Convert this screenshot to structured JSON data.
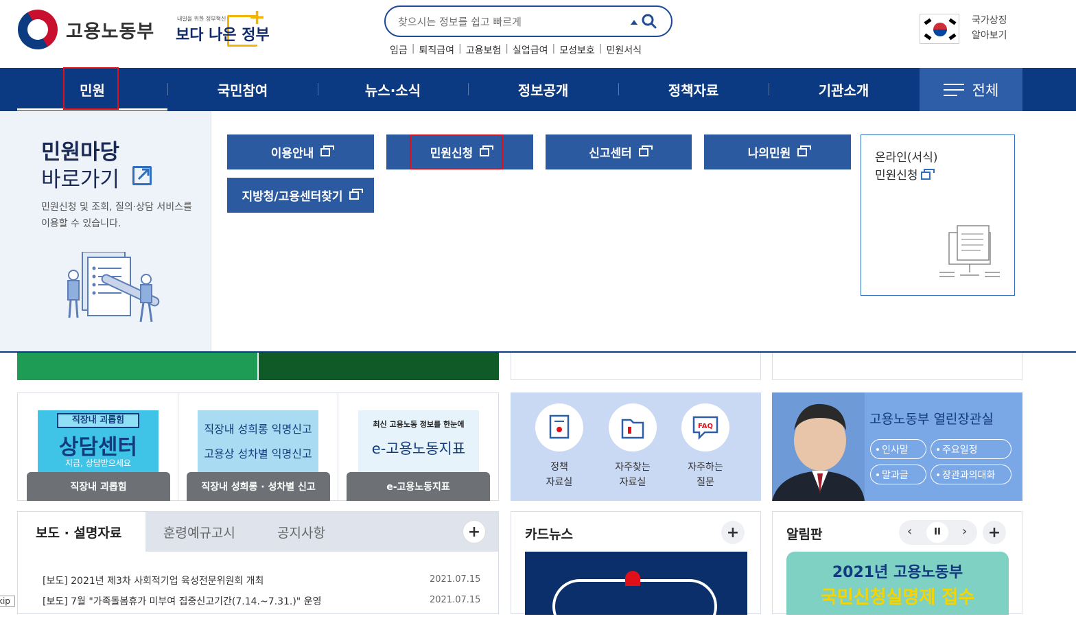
{
  "header": {
    "logo_text": "고용노동부",
    "slogan_small": "내일을 위한 정부혁신",
    "slogan_big": "보다 나은 정부",
    "search_placeholder": "찾으시는 정보를 쉽고 빠르게",
    "quick_links": [
      "임금",
      "퇴직급여",
      "고용보험",
      "실업급여",
      "모성보호",
      "민원서식"
    ],
    "national_symbol_line1": "국가상징",
    "national_symbol_line2": "알아보기"
  },
  "gnb": {
    "items": [
      "민원",
      "국민참여",
      "뉴스·소식",
      "정보공개",
      "정책자료",
      "기관소개"
    ],
    "all_label": "전체"
  },
  "dropdown": {
    "title_line1": "민원마당",
    "title_line2": "바로가기",
    "description": "민원신청 및 조회, 질의·상담 서비스를 이용할 수 있습니다.",
    "buttons": [
      "이용안내",
      "민원신청",
      "신고센터",
      "나의민원",
      "지방청/고용센터찾기"
    ],
    "online_line1": "온라인(서식)",
    "online_line2": "민원신청"
  },
  "promos": [
    {
      "top": "직장내 괴롭힘",
      "main": "상담센터",
      "sub": "지금, 상담받으세요",
      "label": "직장내 괴롭힘"
    },
    {
      "top": "직장내 성희롱 익명신고",
      "main": "고용상 성차별 익명신고",
      "label": "직장내 성희롱 · 성차별 신고"
    },
    {
      "top": "최신 고용노동 정보를 한눈에",
      "main": "e-고용노동지표",
      "label": "e-고용노동지표"
    }
  ],
  "quick_menu": [
    {
      "line1": "정책",
      "line2": "자료실",
      "icon": "book-icon"
    },
    {
      "line1": "자주찾는",
      "line2": "자료실",
      "icon": "folder-icon"
    },
    {
      "line1": "자주하는",
      "line2": "질문",
      "icon": "faq-icon"
    }
  ],
  "minister": {
    "title": "고용노동부 열린장관실",
    "pills": [
      "인사말",
      "주요일정",
      "말과글",
      "장관과의대화"
    ]
  },
  "news": {
    "tabs": [
      "보도 · 설명자료",
      "훈령예규고시",
      "공지사항"
    ],
    "rows": [
      {
        "text": "[보도] 2021년 제3차 사회적기업 육성전문위원회 개최",
        "date": "2021.07.15"
      },
      {
        "text": "[보도] 7월 \"가족돌봄휴가 미부여 집중신고기간(7.14.~7.31.)\" 운영",
        "date": "2021.07.15"
      }
    ]
  },
  "cardnews": {
    "title": "카드뉴스"
  },
  "notice": {
    "title": "알림판",
    "banner_line1": "2021년 고용노동부",
    "banner_line2": "국민신청실명제 접수"
  },
  "skip_label": "kip",
  "colors": {
    "primary": "#0c3a82",
    "button": "#2c5aa0",
    "highlight": "#e0101a"
  }
}
